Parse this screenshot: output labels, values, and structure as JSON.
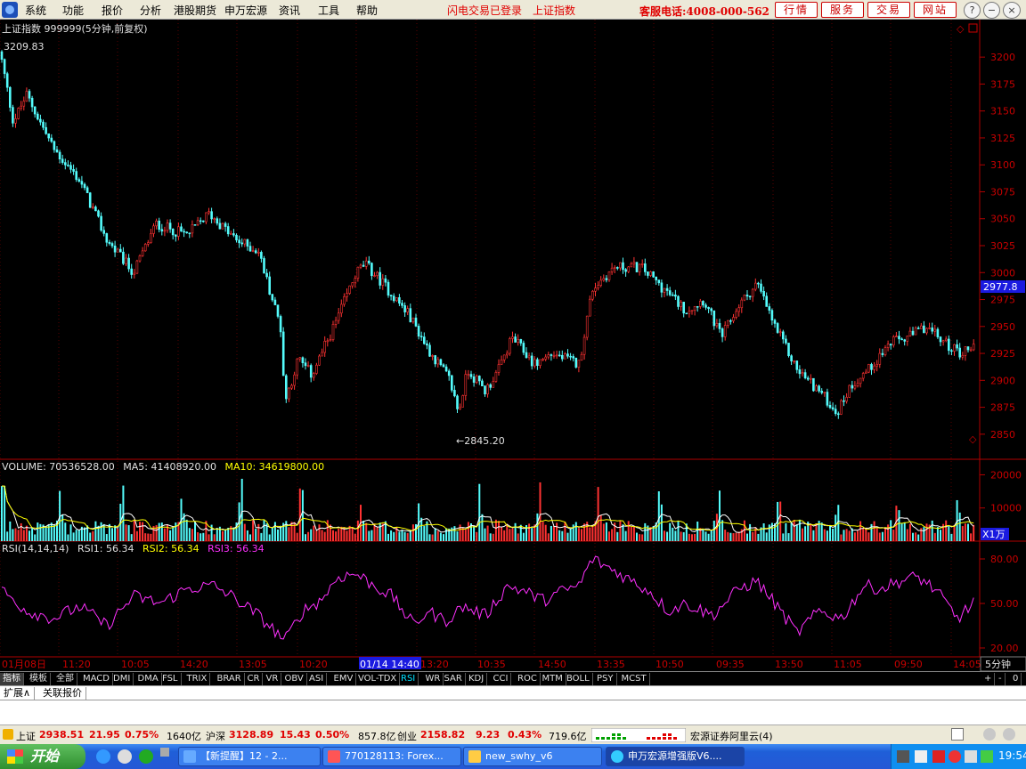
{
  "menubar": {
    "items": [
      "系统",
      "功能",
      "报价",
      "分析",
      "港股期货",
      "申万宏源",
      "资讯",
      "工具",
      "帮助"
    ],
    "flash_status": "闪电交易已登录",
    "index_link": "上证指数",
    "phone": "客服电话:4008-000-562",
    "right_buttons": [
      "行情",
      "服务",
      "交易",
      "网站"
    ],
    "window_controls": [
      "?",
      "−",
      "❐",
      "×"
    ]
  },
  "price_panel": {
    "title": "上证指数 999999(5分钟,前复权)",
    "high_label": "3209.83",
    "low_label": "←2845.20",
    "current_price_tag": "2977.8",
    "y_ticks": [
      "3200",
      "3175",
      "3150",
      "3125",
      "3100",
      "3075",
      "3050",
      "3025",
      "3000",
      "2975",
      "2950",
      "2925",
      "2900",
      "2875",
      "2850"
    ]
  },
  "volume_panel": {
    "label_volume": "VOLUME: 70536528.00",
    "label_ma5": "MA5: 41408920.00",
    "label_ma10": "MA10: 34619800.00",
    "y_ticks": [
      "20000",
      "10000"
    ],
    "unit": "X1万"
  },
  "rsi_panel": {
    "label_params": "RSI(14,14,14)",
    "label_rsi1": "RSI1: 56.34",
    "label_rsi2": "RSI2: 56.34",
    "label_rsi3": "RSI3: 56.34",
    "y_ticks": [
      "80.00",
      "50.00",
      "20.00"
    ]
  },
  "time_axis": {
    "labels": [
      "01月08日",
      "11:20",
      "10:05",
      "14:20",
      "13:05",
      "10:20",
      "01/14 14:40",
      "13:20",
      "10:35",
      "14:50",
      "13:35",
      "10:50",
      "09:35",
      "13:50",
      "11:05",
      "09:50",
      "14:05"
    ],
    "period": "5分钟"
  },
  "indicator_tabs": [
    "指标",
    "模板",
    "全部",
    "MACD",
    "DMI",
    "DMA",
    "FSL",
    "TRIX",
    "BRAR",
    "CR",
    "VR",
    "OBV",
    "ASI",
    "EMV",
    "VOL-TDX",
    "RSI",
    "WR",
    "SAR",
    "KDJ",
    "CCI",
    "ROC",
    "MTM",
    "BOLL",
    "PSY",
    "MCST"
  ],
  "tab_controls": [
    "+",
    "-",
    "0"
  ],
  "sub_tabs": [
    "扩展∧",
    "关联报价"
  ],
  "statusbar": {
    "sh_label": "上证",
    "sh_value": "2938.51",
    "sh_change": "21.95",
    "sh_pct": "0.75%",
    "sh_amount": "1640亿",
    "hs_label": "沪深",
    "hs_value": "3128.89",
    "hs_change": "15.43",
    "hs_pct": "0.50%",
    "hs_amount": "857.8亿",
    "cy_label": "创业",
    "cy_value": "2158.82",
    "cy_change": "9.23",
    "cy_pct": "0.43%",
    "cy_amount": "719.6亿",
    "server": "宏源证券阿里云(4)"
  },
  "taskbar": {
    "start_label": "开始",
    "tasks": [
      "【新提醒】12 - 2...",
      "770128113: Forex...",
      "new_swhy_v6",
      "申万宏源增强版V6...."
    ],
    "clock": "19:54"
  },
  "chart_data": {
    "type": "candlestick",
    "price_range": [
      2835,
      3215
    ],
    "high": 3209.83,
    "low": 2845.2,
    "last": 2977.8,
    "path_anchors": [
      [
        0,
        3205
      ],
      [
        15,
        3140
      ],
      [
        30,
        3165
      ],
      [
        60,
        3115
      ],
      [
        90,
        3085
      ],
      [
        120,
        3030
      ],
      [
        150,
        3000
      ],
      [
        175,
        3045
      ],
      [
        210,
        3035
      ],
      [
        235,
        3055
      ],
      [
        265,
        3030
      ],
      [
        290,
        3020
      ],
      [
        315,
        2950
      ],
      [
        320,
        2880
      ],
      [
        335,
        2920
      ],
      [
        350,
        2905
      ],
      [
        375,
        2950
      ],
      [
        400,
        3000
      ],
      [
        410,
        3008
      ],
      [
        430,
        2990
      ],
      [
        460,
        2960
      ],
      [
        480,
        2930
      ],
      [
        505,
        2900
      ],
      [
        515,
        2870
      ],
      [
        525,
        2910
      ],
      [
        545,
        2890
      ],
      [
        560,
        2910
      ],
      [
        575,
        2940
      ],
      [
        600,
        2915
      ],
      [
        620,
        2925
      ],
      [
        650,
        2915
      ],
      [
        665,
        2985
      ],
      [
        690,
        3005
      ],
      [
        720,
        3005
      ],
      [
        745,
        2985
      ],
      [
        770,
        2965
      ],
      [
        790,
        2975
      ],
      [
        810,
        2940
      ],
      [
        830,
        2970
      ],
      [
        850,
        2990
      ],
      [
        870,
        2950
      ],
      [
        895,
        2910
      ],
      [
        920,
        2890
      ],
      [
        940,
        2870
      ],
      [
        955,
        2895
      ],
      [
        975,
        2910
      ],
      [
        1000,
        2935
      ],
      [
        1020,
        2940
      ],
      [
        1040,
        2950
      ],
      [
        1060,
        2935
      ],
      [
        1080,
        2925
      ],
      [
        1095,
        2935
      ]
    ],
    "volume_range": [
      0,
      22000
    ],
    "volume_ticks": [
      20000,
      10000
    ],
    "rsi_range": [
      20,
      80
    ],
    "rsi_ticks": [
      80,
      50,
      20
    ],
    "rsi_anchors": [
      [
        0,
        60
      ],
      [
        30,
        45
      ],
      [
        60,
        40
      ],
      [
        90,
        48
      ],
      [
        120,
        35
      ],
      [
        150,
        55
      ],
      [
        180,
        50
      ],
      [
        210,
        60
      ],
      [
        240,
        62
      ],
      [
        260,
        55
      ],
      [
        290,
        42
      ],
      [
        320,
        25
      ],
      [
        340,
        45
      ],
      [
        360,
        52
      ],
      [
        380,
        68
      ],
      [
        400,
        70
      ],
      [
        420,
        62
      ],
      [
        440,
        55
      ],
      [
        465,
        35
      ],
      [
        480,
        45
      ],
      [
        500,
        38
      ],
      [
        520,
        48
      ],
      [
        545,
        42
      ],
      [
        570,
        62
      ],
      [
        590,
        58
      ],
      [
        610,
        52
      ],
      [
        630,
        58
      ],
      [
        650,
        62
      ],
      [
        665,
        80
      ],
      [
        690,
        72
      ],
      [
        710,
        65
      ],
      [
        730,
        58
      ],
      [
        750,
        45
      ],
      [
        770,
        50
      ],
      [
        800,
        42
      ],
      [
        830,
        60
      ],
      [
        850,
        65
      ],
      [
        870,
        50
      ],
      [
        895,
        30
      ],
      [
        920,
        45
      ],
      [
        945,
        40
      ],
      [
        970,
        62
      ],
      [
        990,
        60
      ],
      [
        1010,
        65
      ],
      [
        1030,
        68
      ],
      [
        1045,
        62
      ],
      [
        1060,
        52
      ],
      [
        1075,
        40
      ],
      [
        1090,
        48
      ],
      [
        1095,
        55
      ]
    ],
    "colors": {
      "up": "#ff3232",
      "down": "#54fcfc",
      "ma5": "#ffffff",
      "ma10": "#ffff00",
      "rsi": "#ff30ff"
    }
  }
}
